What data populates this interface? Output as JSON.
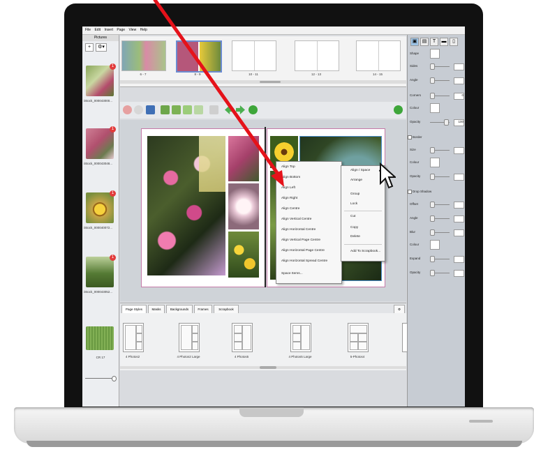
{
  "menu": [
    "File",
    "Edit",
    "Insert",
    "Page",
    "View",
    "Help"
  ],
  "left_panel": {
    "title": "Pictures",
    "add_label": "+",
    "tool_label": "⚙▾",
    "thumbs": [
      {
        "caption": "iStock_000043000...",
        "badge": "1",
        "color": "#6e8d4a"
      },
      {
        "caption": "iStock_000043048...",
        "badge": "1",
        "color": "#b1506e"
      },
      {
        "caption": "iStock_000040072...",
        "badge": "1",
        "color": "#d6a32a"
      },
      {
        "caption": "iStock_000043052...",
        "badge": "1",
        "color": "#557a34"
      },
      {
        "caption": "CR 17",
        "badge": "",
        "color": "#6a9a42"
      }
    ]
  },
  "spreads": [
    {
      "label": "6 - 7"
    },
    {
      "label": "8 - 9"
    },
    {
      "label": "10 - 11"
    },
    {
      "label": "12 - 13"
    },
    {
      "label": "14 - 15"
    }
  ],
  "right_panel": {
    "tabs": [
      "▣",
      "▤",
      "T",
      "▬",
      "▯"
    ],
    "rows": [
      {
        "label": "Shape",
        "value": ""
      },
      {
        "label": "Sides",
        "value": ""
      },
      {
        "label": "Angle",
        "value": ""
      },
      {
        "label": "Corners",
        "value": "0"
      },
      {
        "label": "Colour",
        "value": ""
      },
      {
        "label": "Opacity",
        "value": "100"
      },
      {
        "label": "Border",
        "value": ""
      },
      {
        "label": "Size",
        "value": ""
      },
      {
        "label": "Colour",
        "value": ""
      },
      {
        "label": "Opacity",
        "value": ""
      },
      {
        "label": "Drop Shadow",
        "value": ""
      },
      {
        "label": "Offset",
        "value": ""
      },
      {
        "label": "Angle",
        "value": ""
      },
      {
        "label": "Blur",
        "value": ""
      },
      {
        "label": "Colour",
        "value": ""
      },
      {
        "label": "Expand",
        "value": ""
      },
      {
        "label": "Opacity",
        "value": ""
      }
    ]
  },
  "context_menu": [
    "Align Top",
    "Align Bottom",
    "Align Left",
    "Align Right",
    "Align Centre",
    "Align Vertical Centre",
    "Align Horizontal Centre",
    "Align Vertical Page Centre",
    "Align Horizontal Page Centre",
    "Align Horizontal Spread Centre",
    "Space Items..."
  ],
  "context_menu_main": [
    "Align / Space",
    "Arrange",
    "Group",
    "Lock",
    "Cut",
    "Copy",
    "Delete",
    "Add To Scrapbook..."
  ],
  "bottom_tabs": [
    "Page Styles",
    "Masks",
    "Backgrounds",
    "Frames",
    "Scrapbook"
  ],
  "page_styles": [
    {
      "label": "4 Photos2"
    },
    {
      "label": "4 Photos2 Large"
    },
    {
      "label": "4 Photos5"
    },
    {
      "label": "4 Photos5 Large"
    },
    {
      "label": "5-Photos4"
    }
  ],
  "colors": {
    "arrow": "#e5121a",
    "accent_green": "#3ea63a"
  }
}
